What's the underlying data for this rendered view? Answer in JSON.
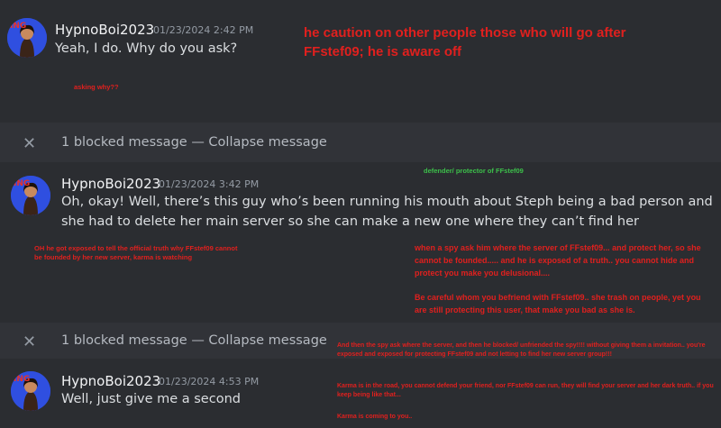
{
  "messages": [
    {
      "username": "HypnoBoi2023",
      "timestamp": "01/23/2024 2:42 PM",
      "text": "Yeah, I do. Why do you ask?"
    },
    {
      "username": "HypnoBoi2023",
      "timestamp": "01/23/2024 3:42 PM",
      "text": "Oh, okay! Well, there’s this guy who’s been running his mouth about Steph being a bad person and she had to delete her main server so she can make a new one where they can’t find her"
    },
    {
      "username": "HypnoBoi2023",
      "timestamp": "01/23/2024 4:53 PM",
      "text": "Well, just give me a second"
    }
  ],
  "blocked": [
    {
      "count_text": "1 blocked message",
      "separator": "—",
      "action": "Collapse message"
    },
    {
      "count_text": "1 blocked message",
      "separator": "—",
      "action": "Collapse message"
    }
  ],
  "annotations": {
    "title": "he caution on other people those who will go after FFstef09; he is aware off",
    "asking": "asking why??",
    "defender": "defender/ protector of FFstef09",
    "exposed": "OH he got exposed to tell the official truth why FFstef09 cannot be founded by her new server, karma is watching",
    "spy1": "when a spy ask him where the server of FFstef09... and protect her, so she cannot be founded..... and he is exposed of a truth.. you cannot hide and protect you make you delusional....",
    "careful": "Be careful whom you befriend with FFstef09.. she trash on people, yet you are still protecting this user, that make you bad as she is.",
    "spy2": "And then the spy ask where the server, and then he blocked/ unfriended the spy!!!! without giving them a invitation.. you're exposed and exposed for protecting FFstef09 and not letting to find her new server group!!!",
    "karma_road": "Karma is in the road, you cannot defend your friend, nor FFstef09 can run, they will find your server and her dark truth.. if you keep being like that...",
    "karma_coming": "Karma is coming to you.."
  },
  "colors": {
    "annotation": "#e0201e",
    "background": "#313338",
    "band": "#2b2d31"
  }
}
